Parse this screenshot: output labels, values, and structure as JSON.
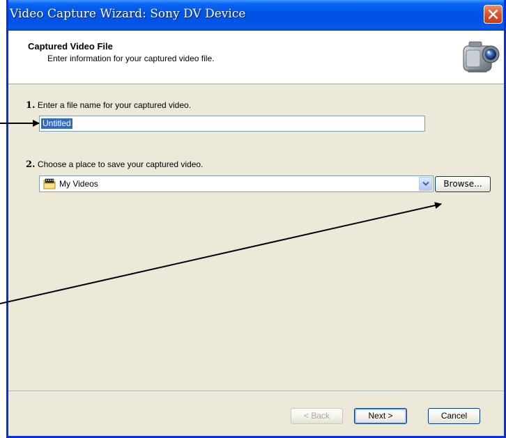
{
  "window": {
    "title": "Video Capture Wizard: Sony DV Device"
  },
  "header": {
    "title": "Captured Video File",
    "subtitle": "Enter information for your captured video file."
  },
  "step1": {
    "number": "1.",
    "label": " Enter a file name for your captured video.",
    "filename_value": "Untitled"
  },
  "step2": {
    "number": "2.",
    "label": " Choose a place to save your captured video.",
    "location_value": "My Videos",
    "browse_label": "Browse..."
  },
  "footer": {
    "back_label": "< Back",
    "next_label": "Next >",
    "cancel_label": "Cancel"
  },
  "icons": {
    "close": "close-icon",
    "camera": "camcorder-icon",
    "folder": "my-videos-folder-icon",
    "dropdown": "chevron-down-icon"
  },
  "colors": {
    "titlebar": "#0054e3",
    "dialog_bg": "#ece9d8",
    "selection": "#316ac5",
    "close_button": "#e0502a"
  }
}
